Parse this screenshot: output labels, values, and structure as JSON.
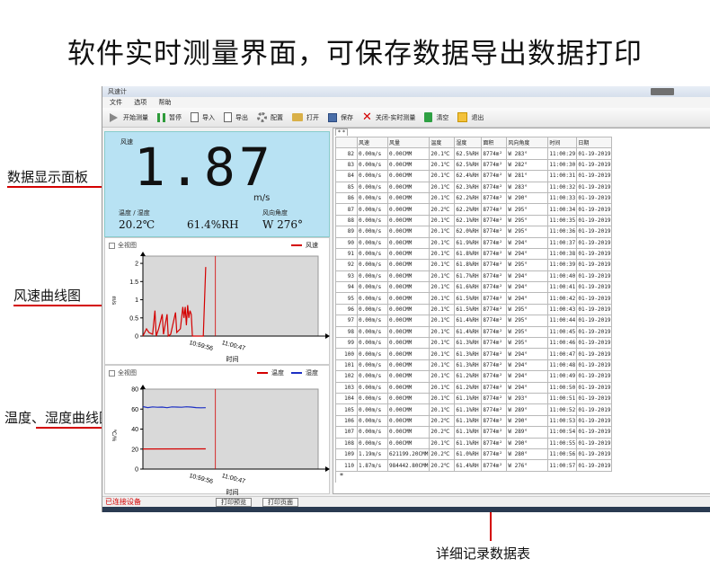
{
  "heading": "软件实时测量界面，可保存数据导出数据打印",
  "callouts": {
    "display_panel": "数据显示面板",
    "wind_curve": "风速曲线图",
    "temp_humidity_curve": "温度、湿度曲线图",
    "detail_table": "详细记录数据表"
  },
  "window": {
    "title": "风速计",
    "menu": [
      "文件",
      "选项",
      "帮助"
    ],
    "toolbar": {
      "start": "开始测量",
      "pause": "暂停",
      "import": "导入",
      "export": "导出",
      "config": "配置",
      "open": "打开",
      "save": "保存",
      "close_realtime": "关闭-实时测量",
      "clear": "清空",
      "exit": "退出"
    }
  },
  "display": {
    "wind_label": "风速",
    "wind_value": "1.87",
    "wind_unit": "m/s",
    "temp_humidity_label": "温度 / 湿度",
    "temperature": "20.2℃",
    "humidity": "61.4%RH",
    "direction_label": "风向角度",
    "direction": "W 276°"
  },
  "wind_chart": {
    "checkbox": "全视图",
    "legend": "风速",
    "ylabel": "m/s",
    "xlabel": "时间",
    "xticks": [
      "10:59:56",
      "11:00:47"
    ],
    "yticks": [
      "0",
      "0.5",
      "1",
      "1.5",
      "2"
    ]
  },
  "th_chart": {
    "checkbox": "全视图",
    "legend_temp": "温度",
    "legend_hum": "湿度",
    "ylabel": "℃/%",
    "xlabel": "时间",
    "xticks": [
      "10:59:56",
      "11:00:47"
    ],
    "yticks": [
      "0",
      "20",
      "40",
      "60",
      "80"
    ]
  },
  "colors": {
    "red": "#d40000",
    "blue": "#1c2fc4",
    "panel_blue": "#b8e2f3"
  },
  "table": {
    "tab": "* *",
    "headers": [
      "",
      "风速",
      "风量",
      "温度",
      "湿度",
      "面积",
      "风向角度",
      "时间",
      "日期"
    ],
    "rows": [
      [
        "82",
        "0.00m/s",
        "0.00CMM",
        "20.1℃",
        "62.5%RH",
        "8774m²",
        "W 283°",
        "11:00:29",
        "01-19-2019"
      ],
      [
        "83",
        "0.00m/s",
        "0.00CMM",
        "20.1℃",
        "62.5%RH",
        "8774m²",
        "W 282°",
        "11:00:30",
        "01-19-2019"
      ],
      [
        "84",
        "0.00m/s",
        "0.00CMM",
        "20.1℃",
        "62.4%RH",
        "8774m²",
        "W 281°",
        "11:00:31",
        "01-19-2019"
      ],
      [
        "85",
        "0.00m/s",
        "0.00CMM",
        "20.1℃",
        "62.3%RH",
        "8774m²",
        "W 283°",
        "11:00:32",
        "01-19-2019"
      ],
      [
        "86",
        "0.00m/s",
        "0.00CMM",
        "20.1℃",
        "62.2%RH",
        "8774m²",
        "W 290°",
        "11:00:33",
        "01-19-2019"
      ],
      [
        "87",
        "0.00m/s",
        "0.00CMM",
        "20.2℃",
        "62.2%RH",
        "8774m²",
        "W 295°",
        "11:00:34",
        "01-19-2019"
      ],
      [
        "88",
        "0.00m/s",
        "0.00CMM",
        "20.1℃",
        "62.1%RH",
        "8774m²",
        "W 295°",
        "11:00:35",
        "01-19-2019"
      ],
      [
        "89",
        "0.00m/s",
        "0.00CMM",
        "20.1℃",
        "62.0%RH",
        "8774m²",
        "W 295°",
        "11:00:36",
        "01-19-2019"
      ],
      [
        "90",
        "0.00m/s",
        "0.00CMM",
        "20.1℃",
        "61.9%RH",
        "8774m²",
        "W 294°",
        "11:00:37",
        "01-19-2019"
      ],
      [
        "91",
        "0.00m/s",
        "0.00CMM",
        "20.1℃",
        "61.8%RH",
        "8774m²",
        "W 294°",
        "11:00:38",
        "01-19-2019"
      ],
      [
        "92",
        "0.00m/s",
        "0.00CMM",
        "20.1℃",
        "61.8%RH",
        "8774m²",
        "W 295°",
        "11:00:39",
        "01-19-2019"
      ],
      [
        "93",
        "0.00m/s",
        "0.00CMM",
        "20.1℃",
        "61.7%RH",
        "8774m²",
        "W 294°",
        "11:00:40",
        "01-19-2019"
      ],
      [
        "94",
        "0.00m/s",
        "0.00CMM",
        "20.1℃",
        "61.6%RH",
        "8774m²",
        "W 294°",
        "11:00:41",
        "01-19-2019"
      ],
      [
        "95",
        "0.00m/s",
        "0.00CMM",
        "20.1℃",
        "61.5%RH",
        "8774m²",
        "W 294°",
        "11:00:42",
        "01-19-2019"
      ],
      [
        "96",
        "0.00m/s",
        "0.00CMM",
        "20.1℃",
        "61.5%RH",
        "8774m²",
        "W 295°",
        "11:00:43",
        "01-19-2019"
      ],
      [
        "97",
        "0.00m/s",
        "0.00CMM",
        "20.1℃",
        "61.4%RH",
        "8774m²",
        "W 295°",
        "11:00:44",
        "01-19-2019"
      ],
      [
        "98",
        "0.00m/s",
        "0.00CMM",
        "20.1℃",
        "61.4%RH",
        "8774m²",
        "W 295°",
        "11:00:45",
        "01-19-2019"
      ],
      [
        "99",
        "0.00m/s",
        "0.00CMM",
        "20.1℃",
        "61.3%RH",
        "8774m²",
        "W 295°",
        "11:00:46",
        "01-19-2019"
      ],
      [
        "100",
        "0.00m/s",
        "0.00CMM",
        "20.1℃",
        "61.3%RH",
        "8774m²",
        "W 294°",
        "11:00:47",
        "01-19-2019"
      ],
      [
        "101",
        "0.00m/s",
        "0.00CMM",
        "20.1℃",
        "61.3%RH",
        "8774m²",
        "W 294°",
        "11:00:48",
        "01-19-2019"
      ],
      [
        "102",
        "0.00m/s",
        "0.00CMM",
        "20.1℃",
        "61.2%RH",
        "8774m²",
        "W 294°",
        "11:00:49",
        "01-19-2019"
      ],
      [
        "103",
        "0.00m/s",
        "0.00CMM",
        "20.1℃",
        "61.2%RH",
        "8774m²",
        "W 294°",
        "11:00:50",
        "01-19-2019"
      ],
      [
        "104",
        "0.00m/s",
        "0.00CMM",
        "20.1℃",
        "61.1%RH",
        "8774m²",
        "W 293°",
        "11:00:51",
        "01-19-2019"
      ],
      [
        "105",
        "0.00m/s",
        "0.00CMM",
        "20.1℃",
        "61.1%RH",
        "8774m²",
        "W 289°",
        "11:00:52",
        "01-19-2019"
      ],
      [
        "106",
        "0.00m/s",
        "0.00CMM",
        "20.2℃",
        "61.1%RH",
        "8774m²",
        "W 290°",
        "11:00:53",
        "01-19-2019"
      ],
      [
        "107",
        "0.00m/s",
        "0.00CMM",
        "20.2℃",
        "61.1%RH",
        "8774m²",
        "W 289°",
        "11:00:54",
        "01-19-2019"
      ],
      [
        "108",
        "0.00m/s",
        "0.00CMM",
        "20.1℃",
        "61.1%RH",
        "8774m²",
        "W 290°",
        "11:00:55",
        "01-19-2019"
      ],
      [
        "109",
        "1.19m/s",
        "621199.20CMM",
        "20.2℃",
        "61.0%RH",
        "8774m²",
        "W 280°",
        "11:00:56",
        "01-19-2019"
      ],
      [
        "110",
        "1.87m/s",
        "984442.80CMM",
        "20.2℃",
        "61.4%RH",
        "8774m²",
        "W 276°",
        "11:00:57",
        "01-19-2019"
      ]
    ],
    "tail_marker": "*"
  },
  "status": {
    "connected": "已连接设备",
    "print_preview": "打印预览",
    "print_page": "打印页面"
  },
  "chart_data": [
    {
      "type": "line",
      "title": "",
      "xlabel": "时间",
      "ylabel": "m/s",
      "ylim": [
        0,
        2.2
      ],
      "legend_placement": "top-right",
      "grid": false,
      "series": [
        {
          "name": "风速",
          "color": "#d40000",
          "points": [
            [
              0,
              0
            ],
            [
              3,
              0.2
            ],
            [
              5,
              0.1
            ],
            [
              8,
              0.05
            ],
            [
              10,
              0.7
            ],
            [
              11,
              0
            ],
            [
              13,
              0.2
            ],
            [
              16,
              0.6
            ],
            [
              17,
              0.05
            ],
            [
              20,
              0.6
            ],
            [
              21,
              0
            ],
            [
              23,
              0.05
            ],
            [
              27,
              0.65
            ],
            [
              28,
              0.1
            ],
            [
              31,
              0.2
            ],
            [
              33,
              0.8
            ],
            [
              34,
              0.5
            ],
            [
              35,
              0.8
            ],
            [
              36,
              0.3
            ],
            [
              37,
              0.85
            ],
            [
              38,
              0.5
            ],
            [
              39,
              0.7
            ],
            [
              40,
              0.6
            ],
            [
              41,
              0
            ],
            [
              44,
              0
            ],
            [
              46,
              0
            ],
            [
              48,
              0
            ],
            [
              50,
              0
            ],
            [
              52,
              1.9
            ]
          ]
        }
      ],
      "marker_x": 60,
      "x_range": [
        0,
        145
      ]
    },
    {
      "type": "line",
      "title": "",
      "xlabel": "时间",
      "ylabel": "℃/%",
      "ylim": [
        0,
        80
      ],
      "legend_placement": "top-right",
      "grid": false,
      "series": [
        {
          "name": "温度",
          "color": "#d40000",
          "points": [
            [
              0,
              20.1
            ],
            [
              52,
              20.2
            ]
          ]
        },
        {
          "name": "湿度",
          "color": "#1c2fc4",
          "points": [
            [
              0,
              62.5
            ],
            [
              4,
              61.5
            ],
            [
              8,
              62.2
            ],
            [
              12,
              61.8
            ],
            [
              16,
              62.0
            ],
            [
              20,
              61.4
            ],
            [
              24,
              62.2
            ],
            [
              28,
              62.0
            ],
            [
              32,
              61.8
            ],
            [
              36,
              62.3
            ],
            [
              40,
              62.0
            ],
            [
              44,
              61.5
            ],
            [
              48,
              61.3
            ],
            [
              52,
              61.4
            ]
          ]
        }
      ],
      "marker_x": 60,
      "x_range": [
        0,
        145
      ]
    }
  ]
}
